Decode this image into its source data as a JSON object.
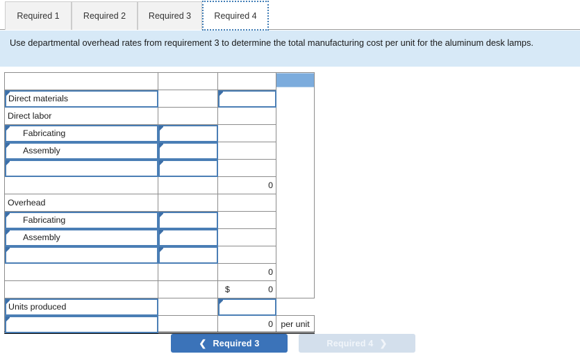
{
  "tabs": [
    {
      "label": "Required 1",
      "active": false
    },
    {
      "label": "Required 2",
      "active": false
    },
    {
      "label": "Required 3",
      "active": false
    },
    {
      "label": "Required 4",
      "active": true
    }
  ],
  "instruction": "Use departmental overhead rates from requirement 3 to determine the total manufacturing cost per unit for the aluminum desk lamps.",
  "worksheet": {
    "columns": [
      "",
      "",
      "",
      ""
    ],
    "rows": [
      {
        "name": "header-row",
        "label": "",
        "label_editable": false,
        "indent": false,
        "mid": "",
        "mid_editable": false,
        "amount": "",
        "amount_editable": false,
        "currency": "",
        "unit": "",
        "header": true
      },
      {
        "name": "direct-materials-row",
        "label": "Direct materials",
        "label_editable": true,
        "indent": false,
        "mid": "",
        "mid_editable": false,
        "amount": "",
        "amount_editable": true,
        "currency": "",
        "unit": ""
      },
      {
        "name": "direct-labor-row",
        "label": "Direct labor",
        "label_editable": false,
        "indent": false,
        "mid": "",
        "mid_editable": false,
        "amount": "",
        "amount_editable": false,
        "currency": "",
        "unit": ""
      },
      {
        "name": "labor-fabricating-row",
        "label": "Fabricating",
        "label_editable": true,
        "indent": true,
        "mid": "",
        "mid_editable": true,
        "amount": "",
        "amount_editable": false,
        "currency": "",
        "unit": ""
      },
      {
        "name": "labor-assembly-row",
        "label": "Assembly",
        "label_editable": true,
        "indent": true,
        "mid": "",
        "mid_editable": true,
        "amount": "",
        "amount_editable": false,
        "currency": "",
        "unit": ""
      },
      {
        "name": "labor-blank-row",
        "label": "",
        "label_editable": true,
        "indent": false,
        "mid": "",
        "mid_editable": true,
        "amount": "",
        "amount_editable": false,
        "currency": "",
        "unit": ""
      },
      {
        "name": "labor-subtotal-row",
        "label": "",
        "label_editable": false,
        "indent": false,
        "mid": "",
        "mid_editable": false,
        "amount": "0",
        "amount_editable": false,
        "currency": "",
        "unit": "",
        "rule": "top"
      },
      {
        "name": "overhead-row",
        "label": "Overhead",
        "label_editable": false,
        "indent": false,
        "mid": "",
        "mid_editable": false,
        "amount": "",
        "amount_editable": false,
        "currency": "",
        "unit": ""
      },
      {
        "name": "oh-fabricating-row",
        "label": "Fabricating",
        "label_editable": true,
        "indent": true,
        "mid": "",
        "mid_editable": true,
        "amount": "",
        "amount_editable": false,
        "currency": "",
        "unit": ""
      },
      {
        "name": "oh-assembly-row",
        "label": "Assembly",
        "label_editable": true,
        "indent": true,
        "mid": "",
        "mid_editable": true,
        "amount": "",
        "amount_editable": false,
        "currency": "",
        "unit": ""
      },
      {
        "name": "oh-blank-row",
        "label": "",
        "label_editable": true,
        "indent": false,
        "mid": "",
        "mid_editable": true,
        "amount": "",
        "amount_editable": false,
        "currency": "",
        "unit": ""
      },
      {
        "name": "oh-subtotal-row",
        "label": "",
        "label_editable": false,
        "indent": false,
        "mid": "",
        "mid_editable": false,
        "amount": "0",
        "amount_editable": false,
        "currency": "",
        "unit": "",
        "rule": "top"
      },
      {
        "name": "total-cost-row",
        "label": "",
        "label_editable": false,
        "indent": false,
        "mid": "",
        "mid_editable": false,
        "amount": "0",
        "amount_editable": false,
        "currency": "$",
        "unit": ""
      },
      {
        "name": "units-produced-row",
        "label": "Units produced",
        "label_editable": true,
        "indent": false,
        "mid": "",
        "mid_editable": false,
        "amount": "",
        "amount_editable": true,
        "currency": "",
        "unit": ""
      },
      {
        "name": "cost-per-unit-row",
        "label": "",
        "label_editable": true,
        "indent": false,
        "mid": "",
        "mid_editable": false,
        "amount": "0",
        "amount_editable": false,
        "currency": "",
        "unit": "per unit",
        "rule": "double-bottom"
      }
    ]
  },
  "nav": {
    "prev_label": "Required 3",
    "prev_icon": "chevron-left-icon",
    "next_label": "Required 4",
    "next_icon": "chevron-right-icon"
  },
  "colors": {
    "header_blue": "#7cacdd",
    "banner_blue": "#d7e9f7",
    "edit_outline": "#4a7eb5",
    "button_primary": "#3b73b9",
    "button_disabled": "#d3dfec"
  }
}
